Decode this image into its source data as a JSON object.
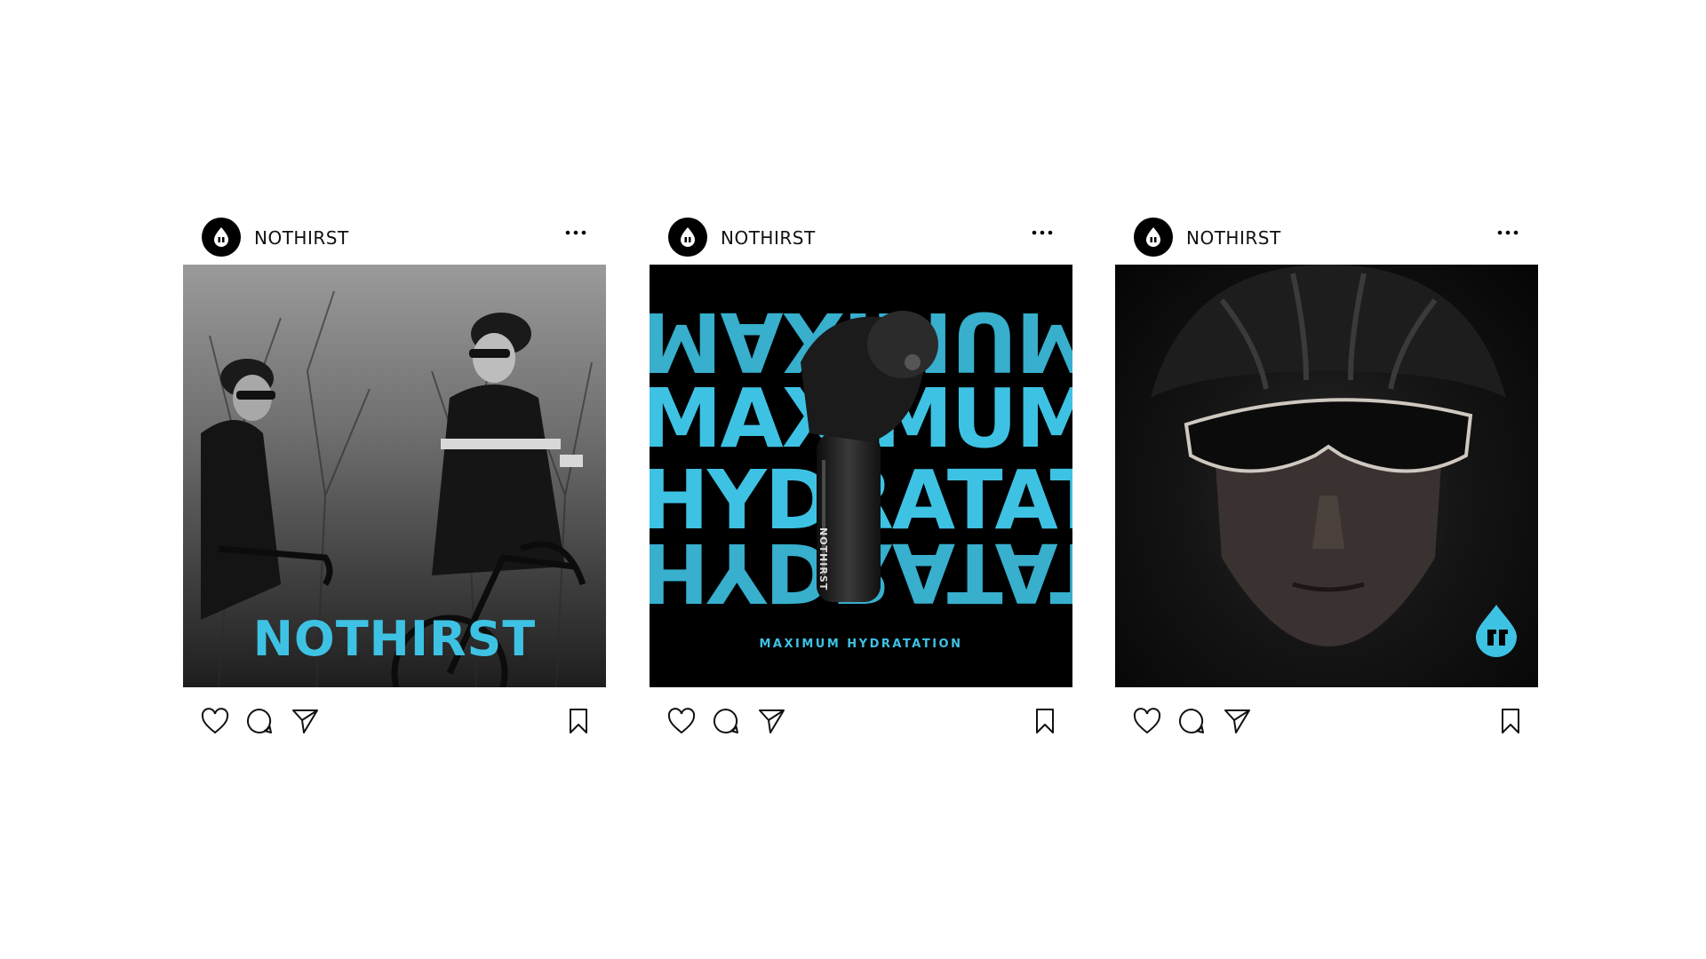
{
  "colors": {
    "accent": "#3ec2e4",
    "background": "#ffffff",
    "ink": "#000000"
  },
  "posts": [
    {
      "username": "NOTHIRST",
      "overlay_title": "NOTHIRST",
      "icons": [
        "more-options-icon",
        "heart-icon",
        "comment-icon",
        "share-icon",
        "bookmark-icon"
      ]
    },
    {
      "username": "NOTHIRST",
      "headline_lines": [
        "MAXIMUM",
        "MAXIMUM",
        "HYDRATATION",
        "HYDRATATION"
      ],
      "caption": "MAXIMUM HYDRATATION",
      "product_label": "NOTHIRST",
      "icons": [
        "more-options-icon",
        "heart-icon",
        "comment-icon",
        "share-icon",
        "bookmark-icon"
      ]
    },
    {
      "username": "NOTHIRST",
      "icons": [
        "more-options-icon",
        "heart-icon",
        "comment-icon",
        "share-icon",
        "bookmark-icon",
        "drop-logo-icon"
      ]
    }
  ]
}
